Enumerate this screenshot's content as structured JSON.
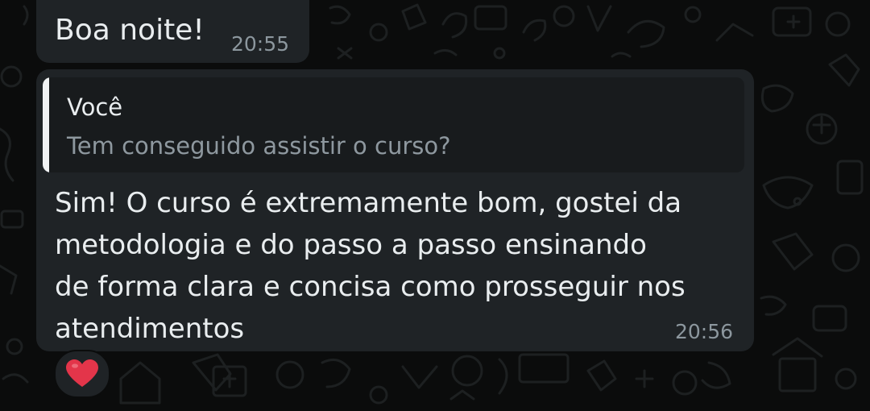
{
  "messages": [
    {
      "text": "Boa noite!",
      "time": "20:55"
    },
    {
      "quote": {
        "author": "Você",
        "text": "Tem conseguido assistir o curso?"
      },
      "lines": [
        "Sim! O curso é extremamente bom, gostei da",
        "metodologia e do passo a passo ensinando",
        "de forma clara e concisa como prosseguir nos",
        "atendimentos"
      ],
      "time": "20:56",
      "reaction": "heart-icon"
    }
  ],
  "colors": {
    "background": "#0b0c0c",
    "bubble": "#1f2326",
    "quote_background": "#181b1d",
    "quote_bar": "#f1f3f4",
    "text": "#e9edef",
    "muted_text": "#8c979e",
    "heart": "#e3354a"
  }
}
